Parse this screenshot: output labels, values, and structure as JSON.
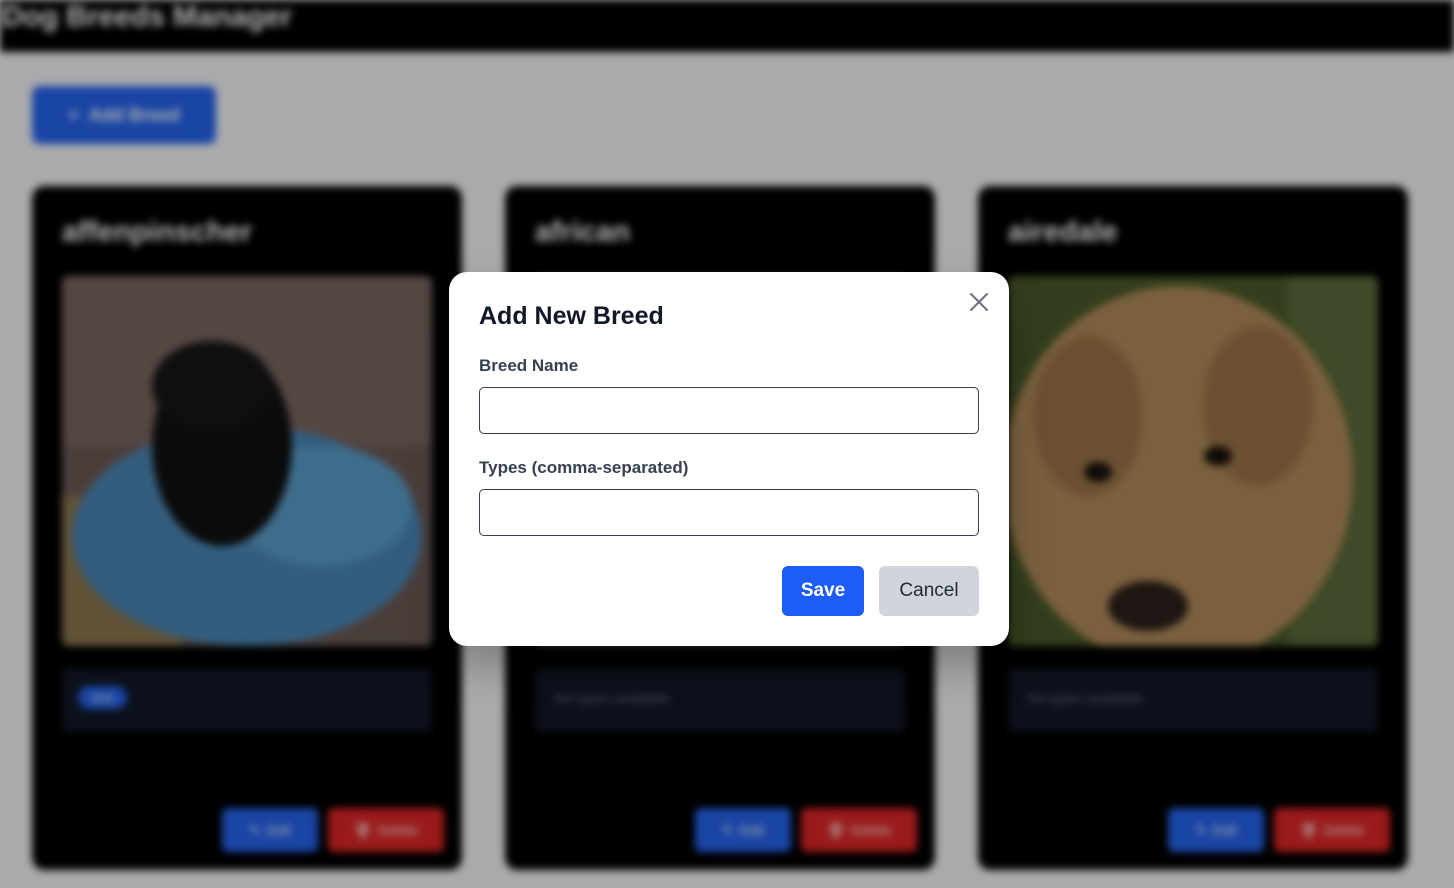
{
  "app": {
    "title": "Dog Breeds Manager",
    "add_button_label": "Add Breed",
    "cards": [
      {
        "name": "affenpinscher",
        "types": [
          "test"
        ],
        "empty_types_text": "",
        "edit_label": "Edit",
        "delete_label": "Delete"
      },
      {
        "name": "african",
        "types": [],
        "empty_types_text": "No types available",
        "edit_label": "Edit",
        "delete_label": "Delete"
      },
      {
        "name": "airedale",
        "types": [],
        "empty_types_text": "No types available",
        "edit_label": "Edit",
        "delete_label": "Delete"
      }
    ]
  },
  "modal": {
    "title": "Add New Breed",
    "breed_name_label": "Breed Name",
    "breed_name_value": "",
    "breed_name_placeholder": "",
    "types_label": "Types (comma-separated)",
    "types_value": "",
    "types_placeholder": "",
    "save_label": "Save",
    "cancel_label": "Cancel",
    "close_icon": "close-icon"
  },
  "colors": {
    "primary": "#1d5cf5",
    "danger": "#dc2626",
    "topbar": "#000000",
    "card": "#000000"
  }
}
